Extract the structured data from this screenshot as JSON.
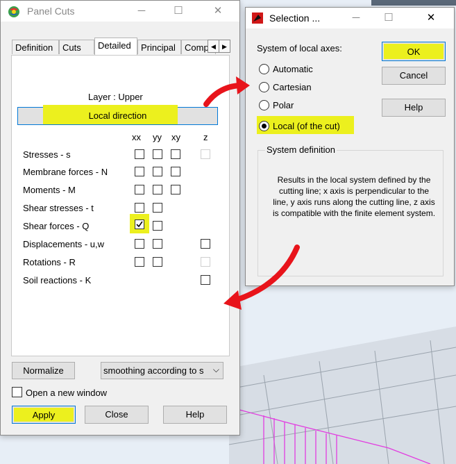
{
  "panel_cuts": {
    "title": "Panel Cuts",
    "tabs": [
      "Definition",
      "Cuts",
      "Detailed",
      "Principal",
      "Comple"
    ],
    "active_tab": "Detailed",
    "layer_label": "Layer : Upper",
    "local_direction_button": "Local direction",
    "columns": [
      "xx",
      "yy",
      "xy",
      "z"
    ],
    "rows": [
      {
        "label": "Stresses - s"
      },
      {
        "label": "Membrane forces - N"
      },
      {
        "label": "Moments - M"
      },
      {
        "label": "Shear stresses - t"
      },
      {
        "label": "Shear forces - Q"
      },
      {
        "label": "Displacements - u,w"
      },
      {
        "label": "Rotations - R"
      },
      {
        "label": "Soil reactions - K"
      }
    ],
    "normalize_button": "Normalize",
    "smoothing_value": "smoothing according to s",
    "open_new_window_label": "Open a new window",
    "apply_button": "Apply",
    "close_button": "Close",
    "help_button": "Help"
  },
  "selection_dialog": {
    "title": "Selection ...",
    "system_label": "System of local axes:",
    "options": [
      "Automatic",
      "Cartesian",
      "Polar",
      "Local (of the cut)"
    ],
    "selected_option": "Local (of the cut)",
    "ok_button": "OK",
    "cancel_button": "Cancel",
    "help_button": "Help",
    "definition_group_label": "System definition",
    "definition_text": "Results in the local system defined by the cutting line; x axis is perpendicular to the line, y axis runs along the cutting line, z axis is compatible with the finite element system."
  },
  "colors": {
    "highlight": "#ecf01e",
    "annotation_arrow": "#e8141b",
    "mesh_lines": "#e23ce0"
  }
}
